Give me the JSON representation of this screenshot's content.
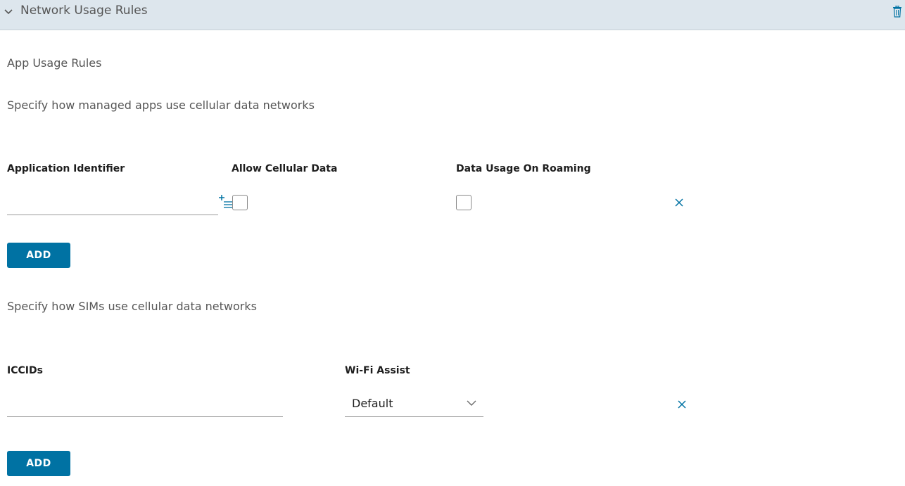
{
  "header": {
    "title": "Network Usage Rules",
    "collapse_icon": "chevron-down-icon",
    "delete_icon": "trash-icon"
  },
  "app_rules": {
    "section_title": "App Usage Rules",
    "description": "Specify how managed apps use cellular data networks",
    "columns": {
      "app_id": "Application Identifier",
      "allow_cellular": "Allow Cellular Data",
      "roaming": "Data Usage On Roaming"
    },
    "row": {
      "app_id_value": "",
      "allow_cellular_checked": false,
      "roaming_checked": false
    },
    "add_label": "ADD"
  },
  "sim_rules": {
    "description": "Specify how SIMs use cellular data networks",
    "columns": {
      "iccids": "ICCIDs",
      "wifi_assist": "Wi-Fi Assist"
    },
    "row": {
      "iccids_value": "",
      "wifi_assist_value": "Default"
    },
    "add_label": "ADD"
  },
  "colors": {
    "header_bg": "#dde6ed",
    "primary": "#0072a3",
    "icon_blue": "#0072a3"
  }
}
